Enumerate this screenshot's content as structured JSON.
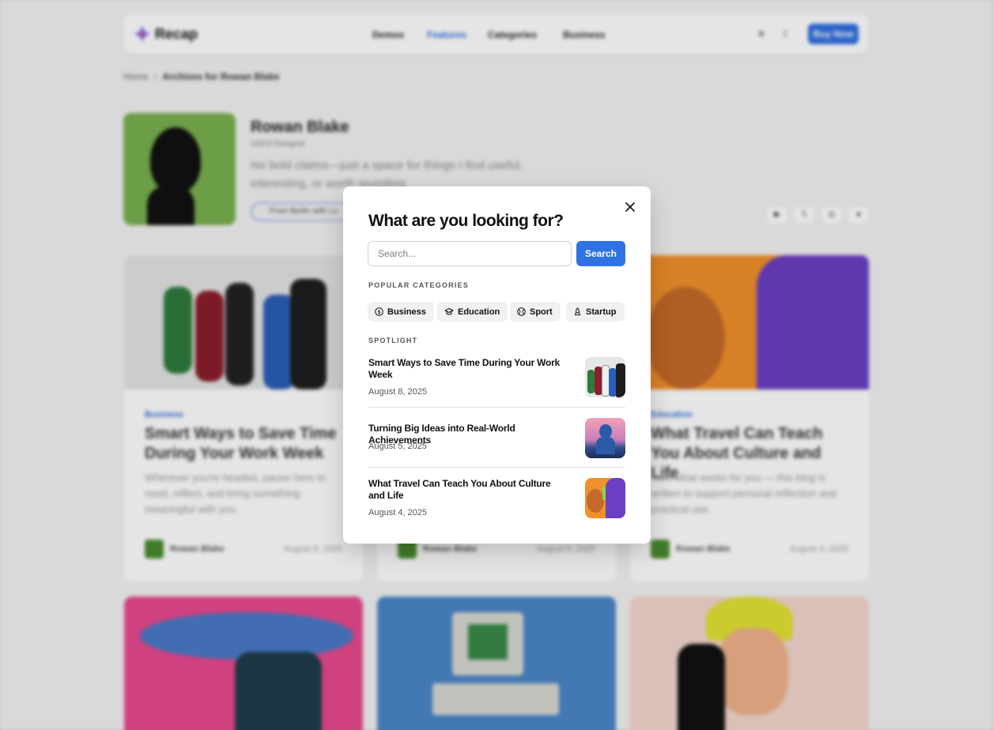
{
  "background": {
    "logo": "Recap",
    "nav": [
      "Demos",
      "Features",
      "Categories",
      "Business"
    ],
    "buy_button": "Buy Now",
    "breadcrumb": {
      "home": "Home",
      "current": "Archives for Rowan Blake"
    },
    "author": {
      "name": "Rowan Blake",
      "role": "UX/UI Designer",
      "bio": "No bold claims—just a space for things I find useful, interesting, or worth revisiting.",
      "pill": "From Berlin with Lo"
    },
    "cards": [
      {
        "category": "Business",
        "title": "Smart Ways to Save Time During Your Work Week",
        "excerpt": "Wherever you're headed, pause here to reset, reflect, and bring something meaningful with you.",
        "author": "Rowan Blake",
        "date": "August 8, 2025"
      },
      {
        "category": "",
        "title": "",
        "excerpt": "",
        "author": "Rowan Blake",
        "date": "August 5, 2025"
      },
      {
        "category": "Education",
        "title": "What Travel Can Teach You About Culture and Life",
        "excerpt": "Take what works for you — this blog is written to support personal reflection and practical use.",
        "author": "Rowan Blake",
        "date": "August 4, 2025"
      }
    ]
  },
  "modal": {
    "title": "What are you looking for?",
    "search_placeholder": "Search...",
    "search_button": "Search",
    "categories_label": "POPULAR CATEGORIES",
    "categories": [
      {
        "label": "Business",
        "icon": "dollar-icon"
      },
      {
        "label": "Education",
        "icon": "graduation-cap-icon"
      },
      {
        "label": "Sport",
        "icon": "ball-icon"
      },
      {
        "label": "Startup",
        "icon": "rocket-icon"
      }
    ],
    "spotlight_label": "SPOTLIGHT",
    "spotlight": [
      {
        "title": "Smart Ways to Save Time During Your Work Week",
        "date": "August 8, 2025"
      },
      {
        "title": "Turning Big Ideas into Real-World Achievements",
        "date": "August 5, 2025"
      },
      {
        "title": "What Travel Can Teach You About Culture and Life",
        "date": "August 4, 2025"
      }
    ]
  },
  "colors": {
    "accent": "#2f72e3",
    "chip_bg": "#f1f1f1"
  }
}
